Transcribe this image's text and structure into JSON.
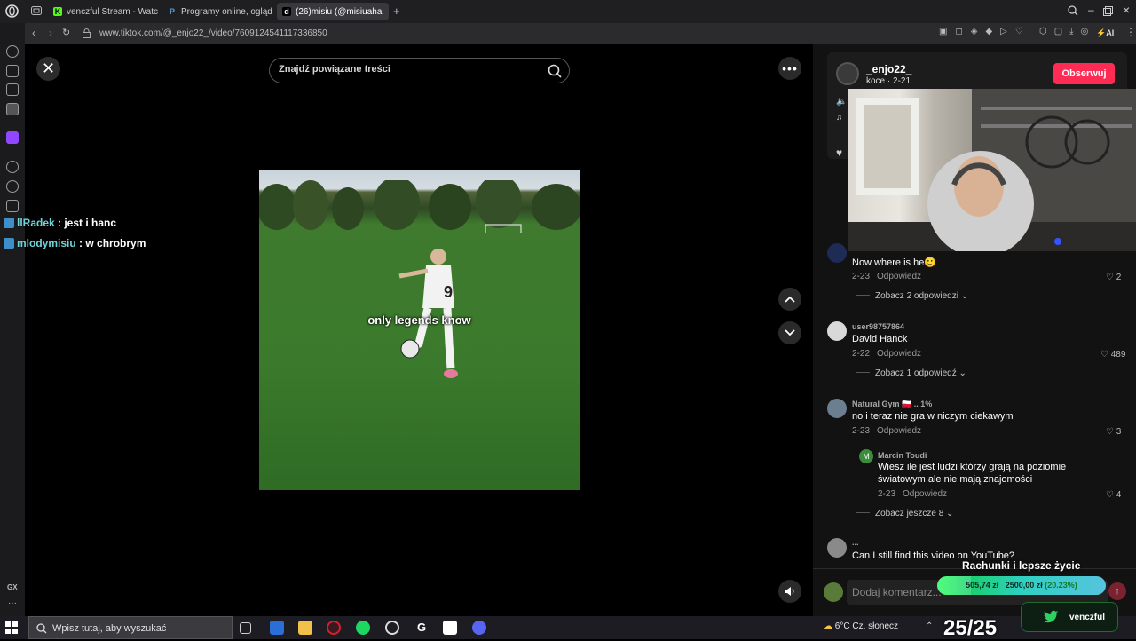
{
  "browser": {
    "tabs": [
      {
        "label": "venczful Stream - Watch L",
        "favicon_color": "#53fc18",
        "favicon": "K"
      },
      {
        "label": "Programy online, oglądaj r",
        "favicon_color": "#5b9bd5",
        "favicon": "P"
      },
      {
        "label": "(26)misiu (@misiuaha",
        "favicon_color": "#ffffff",
        "favicon": "d"
      }
    ],
    "url": "www.tiktok.com/@_enjo22_/video/7609124541117336850"
  },
  "sidebar": {
    "bottom_label": "GX"
  },
  "chat": [
    {
      "user": "llRadek",
      "message": " : jest i hanc"
    },
    {
      "user": "mlodymisiu",
      "message": " : w chrobrym"
    }
  ],
  "search": {
    "placeholder": "Znajdź powiązane treści"
  },
  "video": {
    "caption": "only legends know"
  },
  "author": {
    "username": "_enjo22_",
    "sub": "koce · 2-21",
    "follow_label": "Obserwuj"
  },
  "comments": [
    {
      "user": "",
      "text": "Now where is he🥲",
      "date": "2-23",
      "reply": "Odpowiedz",
      "likes": "2",
      "more": "Zobacz 2 odpowiedzi"
    },
    {
      "user": "user98757864",
      "text": "David Hanck",
      "date": "2-22",
      "reply": "Odpowiedz",
      "likes": "489",
      "more": "Zobacz 1 odpowiedź"
    },
    {
      "user": "Natural Gym 🇵🇱 .. 1%",
      "text": "no i teraz nie gra w niczym ciekawym",
      "date": "2-23",
      "reply": "Odpowiedz",
      "likes": "3"
    },
    {
      "user": "Marcin Toudi",
      "text1": "Wiesz ile jest ludzi którzy grają na poziomie",
      "text2": "światowym ale nie mają znajomości",
      "date": "2-23",
      "reply": "Odpowiedz",
      "likes": "4",
      "more": "Zobacz jeszcze 8"
    },
    {
      "user": "...",
      "text": "Can I still find this video on YouTube?"
    }
  ],
  "comment_input": {
    "placeholder": "Dodaj komentarz..."
  },
  "goal": {
    "title": "Rachunki i lepsze życie",
    "current": "505,74 zł",
    "target": "2500,00 zł",
    "percent": "(20.23%)",
    "fraction": 0.2023
  },
  "taskbar": {
    "search_text": "Wpisz tutaj, aby wyszukać",
    "weather": "6°C  Cz. słonecz",
    "counter": "25/25"
  },
  "twitter": {
    "handle": "venczful"
  }
}
